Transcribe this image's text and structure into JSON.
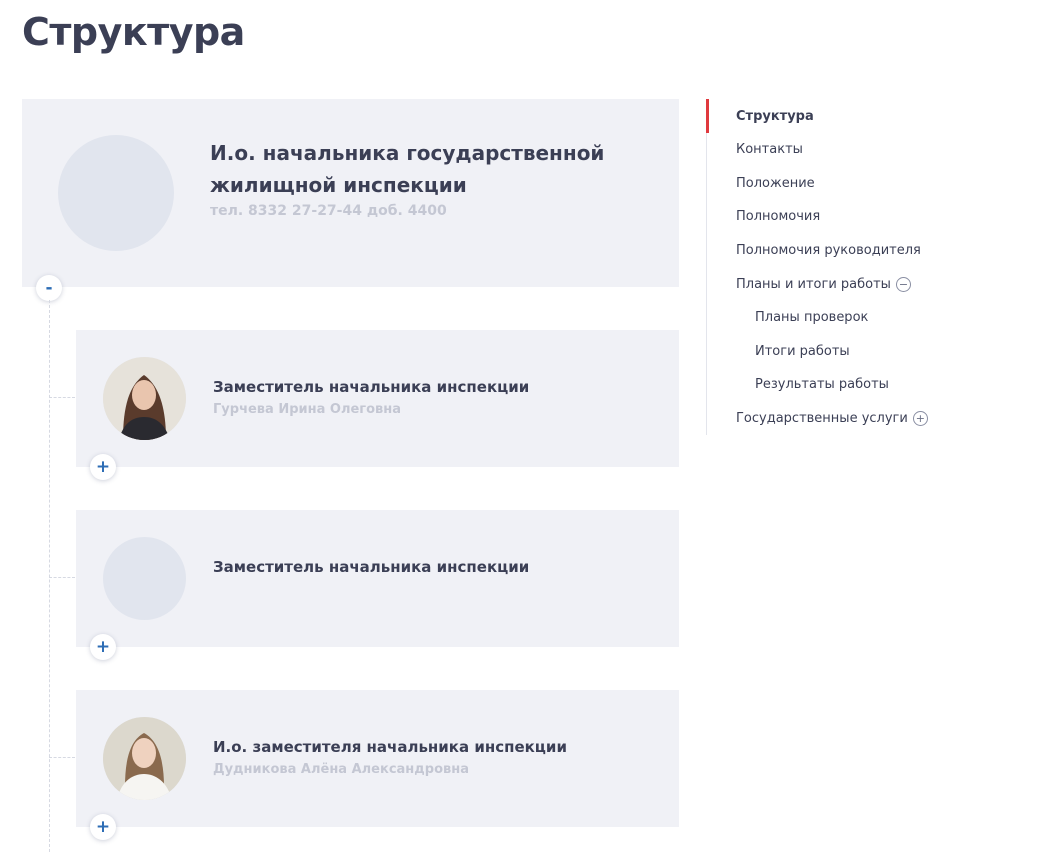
{
  "page": {
    "title": "Структура"
  },
  "head": {
    "title_line1": "И.о. начальника государственной",
    "title_line2": "жилищной инспекции",
    "phone": "тел. 8332 27-27-44 доб. 4400",
    "toggle": "-"
  },
  "cards": [
    {
      "title": "Заместитель начальника инспекции",
      "name": "Гурчева Ирина Олеговна",
      "toggle": "+"
    },
    {
      "title": "Заместитель начальника инспекции",
      "name": "",
      "toggle": "+"
    },
    {
      "title": "И.о. заместителя начальника инспекции",
      "name": "Дудникова Алёна Александровна",
      "toggle": "+"
    }
  ],
  "nav": {
    "items": [
      {
        "label": "Структура"
      },
      {
        "label": "Контакты"
      },
      {
        "label": "Положение"
      },
      {
        "label": "Полномочия"
      },
      {
        "label": "Полномочия руководителя"
      },
      {
        "label": "Планы и итоги работы",
        "toggle": "−"
      },
      {
        "label": "Планы проверок"
      },
      {
        "label": "Итоги работы"
      },
      {
        "label": "Результаты работы"
      },
      {
        "label": "Государственные услуги",
        "toggle": "+"
      }
    ]
  },
  "colors": {
    "accent": "#e0393e",
    "card_bg": "#f0f1f6",
    "text": "#3b3f55",
    "muted": "#c4c7d3",
    "toggle": "#2d6db5"
  }
}
